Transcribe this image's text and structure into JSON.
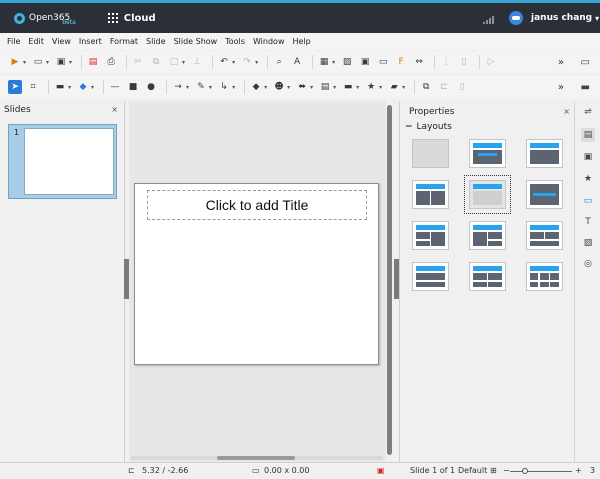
{
  "topbar": {
    "logo_text": "Open365",
    "logo_badge": "beta",
    "app_title": "Cloud",
    "user_name": "janus chang",
    "accent": "#35a3d6"
  },
  "menu": [
    "File",
    "Edit",
    "View",
    "Insert",
    "Format",
    "Slide",
    "Slide Show",
    "Tools",
    "Window",
    "Help"
  ],
  "slides_pane": {
    "title": "Slides",
    "close": "×",
    "slide_number": "1"
  },
  "canvas": {
    "title_placeholder": "Click to add Title"
  },
  "properties": {
    "title": "Properties",
    "close": "×",
    "section_toggle": "−",
    "section": "Layouts"
  },
  "status": {
    "position": "5.32 / -2.66",
    "size": "0.00 x 0.00",
    "slide_info": "Slide 1 of 1",
    "master": "Default",
    "zoom_minus": "−",
    "zoom_plus": "+",
    "zoom_value": "3"
  },
  "toolbar": {
    "more": "»"
  }
}
